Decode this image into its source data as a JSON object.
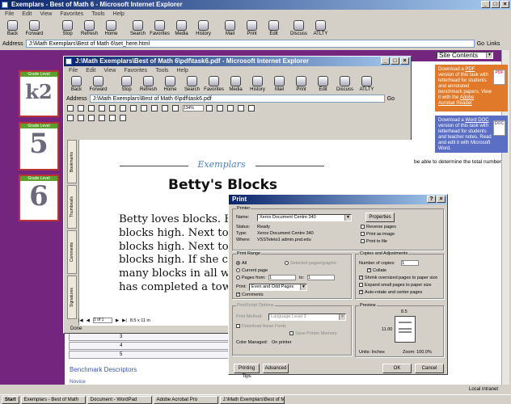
{
  "browser": {
    "title": "Exemplars - Best of Math 6 - Microsoft Internet Explorer",
    "menu": [
      "File",
      "Edit",
      "View",
      "Favorites",
      "Tools",
      "Help"
    ],
    "toolbar": [
      "Back",
      "Forward",
      "Stop",
      "Refresh",
      "Home",
      "Search",
      "Favorites",
      "Media",
      "History",
      "Mail",
      "Print",
      "Edit",
      "Discuss",
      "ATLTY"
    ],
    "address_label": "Address",
    "address": "J:\\Math Exemplars\\Best of Math 6\\set_here.html",
    "go": "Go",
    "links": "Links",
    "site_contents": "Site Contents"
  },
  "thumbs": [
    {
      "label": "Grade Level",
      "art": "k2"
    },
    {
      "label": "Grade Level",
      "art": "5"
    },
    {
      "label": "Grade Level",
      "art": "6"
    }
  ],
  "side_pdf": {
    "text_pre": "Download a ",
    "link": "PDF",
    "text_post": " version of this task with letterhead for students and annotated benchmark papers. View it with the ",
    "reader": "Adobe Acrobat Reader",
    "icon_label": "PDF"
  },
  "side_doc": {
    "text_pre": "Download a ",
    "link": "Word DOC",
    "text_post": " version of this task with letterhead for students and teacher notes. Read and edit it with Microsoft Word.",
    "icon_label": "DOC"
  },
  "page": {
    "peek_text": "be able to determine the total number",
    "table_rows": [
      "3",
      "4",
      "5"
    ],
    "benchmark_heading": "Benchmark Descriptors",
    "novice": "Novice"
  },
  "pdf_window": {
    "title": "J:\\Math Exemplars\\Best of Math 6\\pdf\\task6.pdf - Microsoft Internet Explorer",
    "menu": [
      "File",
      "Edit",
      "View",
      "Favorites",
      "Tools",
      "Help"
    ],
    "toolbar": [
      "Back",
      "Forward",
      "Stop",
      "Refresh",
      "Home",
      "Search",
      "Favorites",
      "Media",
      "History",
      "Mail",
      "Print",
      "Edit",
      "Discuss",
      "ATLTY"
    ],
    "address": "J:\\Math Exemplars\\Best of Math 6\\pdf\\task6.pdf",
    "go": "Go",
    "zoom": "134%",
    "page_nav": "1 of 1",
    "page_size": "8.5 x 11 in",
    "status": "Done",
    "side_tabs": [
      "Bookmarks",
      "Thumbnails",
      "Comments",
      "Signatures"
    ]
  },
  "document": {
    "exemplars": "Exemplars",
    "title": "Betty's Blocks",
    "lines": [
      "Betty loves blocks. Fir",
      "blocks high. Next to it",
      "blocks high. Next to th",
      "blocks high. If she cor",
      "many blocks in all wil",
      "has completed a towe"
    ]
  },
  "print_dialog": {
    "title": "Print",
    "printer_group": "Printer",
    "name_label": "Name:",
    "printer_name": "Xerox Document Centre 340",
    "properties": "Properties",
    "status_label": "Status:",
    "status": "Ready",
    "type_label": "Type:",
    "type": "Xerox Document Centre 340",
    "where_label": "Where:",
    "where": "VSSTeleto1 admin.pnd.edu",
    "reverse": "Reverse pages",
    "print_image": "Print as image",
    "print_file": "Print to file",
    "range_group": "Print Range",
    "all": "All",
    "current_page": "Current page",
    "pages_from": "Pages from:",
    "from_val": "1",
    "to_label": "to:",
    "to_val": "1",
    "selected_graphic": "Selected pages/graphic",
    "print_label": "Print:",
    "print_option": "Even and Odd Pages",
    "comments": "Comments",
    "copies_group": "Copies and Adjustments",
    "num_copies": "Number of copies:",
    "copies_val": "1",
    "collate": "Collate",
    "shrink": "Shrink oversized pages to paper size",
    "expand": "Expand small pages to paper size",
    "autorotate": "Auto-rotate and center pages",
    "postscript_group": "PostScript Options",
    "print_method": "Print Method:",
    "print_method_val": "Language Level 3",
    "download_fonts": "Download Asian Fonts",
    "save_memory": "Save Printer Memory",
    "color_managed": "Color Managed:",
    "color_managed_val": "On printer",
    "preview_group": "Preview",
    "preview_width": "8.5",
    "preview_height": "11.00",
    "units": "Units: Inches",
    "zoom": "Zoom: 100.0%",
    "printing_tips": "Printing Tips",
    "advanced": "Advanced",
    "ok": "OK",
    "cancel": "Cancel"
  },
  "status_bar": {
    "zone": "Local intranet"
  },
  "taskbar": {
    "start": "Start",
    "tasks": [
      "Exemplars - Best of Math",
      "Document - WordPad",
      "Adobe Acrobat Pro",
      "J:\\Math Exemplars\\Best of Math 6"
    ]
  }
}
